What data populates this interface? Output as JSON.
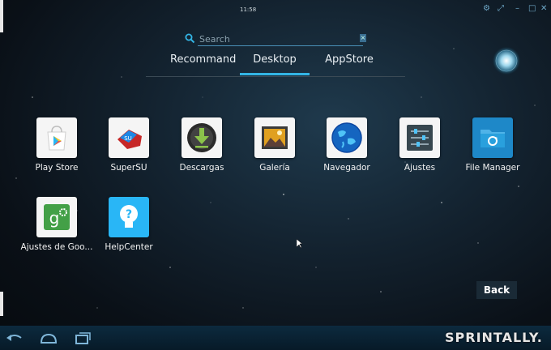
{
  "status_bar": {
    "clock": "11:58"
  },
  "search": {
    "placeholder": "Search"
  },
  "tabs": [
    {
      "label": "Recommand",
      "active": false
    },
    {
      "label": "Desktop",
      "active": true
    },
    {
      "label": "AppStore",
      "active": false
    }
  ],
  "apps": [
    {
      "label": "Play Store",
      "icon": "play-store-icon"
    },
    {
      "label": "SuperSU",
      "icon": "supersu-icon"
    },
    {
      "label": "Descargas",
      "icon": "download-icon"
    },
    {
      "label": "Galería",
      "icon": "gallery-icon"
    },
    {
      "label": "Navegador",
      "icon": "browser-globe-icon"
    },
    {
      "label": "Ajustes",
      "icon": "settings-sliders-icon"
    },
    {
      "label": "File Manager",
      "icon": "folder-icon"
    },
    {
      "label": "Ajustes de Goo...",
      "icon": "google-settings-icon"
    },
    {
      "label": "HelpCenter",
      "icon": "help-bulb-icon"
    }
  ],
  "buttons": {
    "back": "Back"
  },
  "watermark": "SPRINTALLY.",
  "colors": {
    "accent": "#33b5e5",
    "navbar": "#0c2a3e"
  }
}
